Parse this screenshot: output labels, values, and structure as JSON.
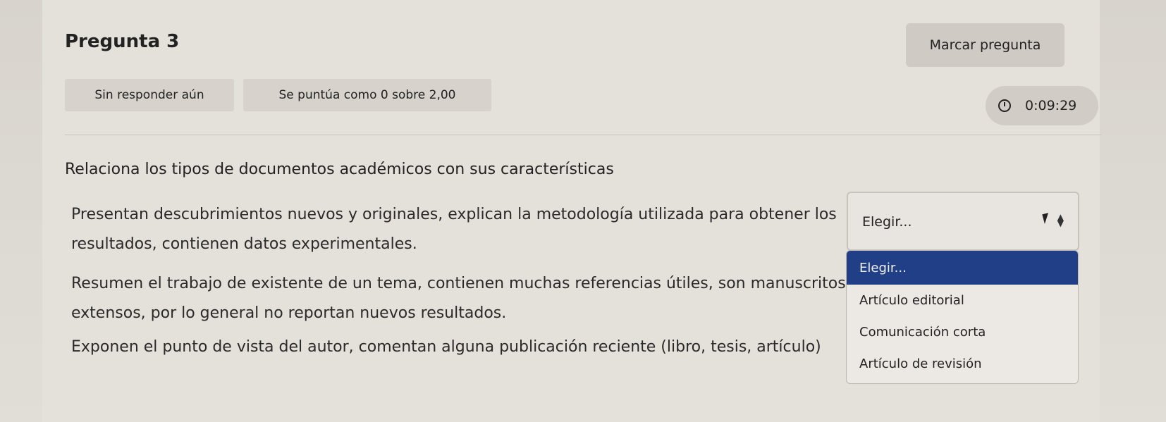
{
  "question": {
    "title": "Pregunta 3",
    "flag_label": "Marcar pregunta",
    "state": "Sin responder aún",
    "grade": "Se puntúa como 0 sobre 2,00",
    "timer": "0:09:29",
    "prompt": "Relaciona los tipos de documentos académicos con sus características"
  },
  "stems": [
    "Presentan descubrimientos nuevos y originales, explican la metodología utilizada para obtener los resultados, contienen datos experimentales.",
    "Resumen el trabajo de existente de un tema, contienen muchas referencias útiles, son manuscritos extensos, por lo general no reportan nuevos resultados.",
    "Exponen el punto de vista del autor, comentan alguna publicación reciente (libro, tesis, artículo)"
  ],
  "select": {
    "current_value": "Elegir...",
    "options": [
      "Elegir...",
      "Artículo editorial",
      "Comunicación corta",
      "Artículo de revisión"
    ]
  },
  "icons": {
    "timer": "clock-icon",
    "select": "chevron-updown-icon",
    "pointer": "cursor-icon"
  },
  "colors": {
    "selected_option_bg": "#203f86",
    "page_bg": "#e4e0da"
  }
}
